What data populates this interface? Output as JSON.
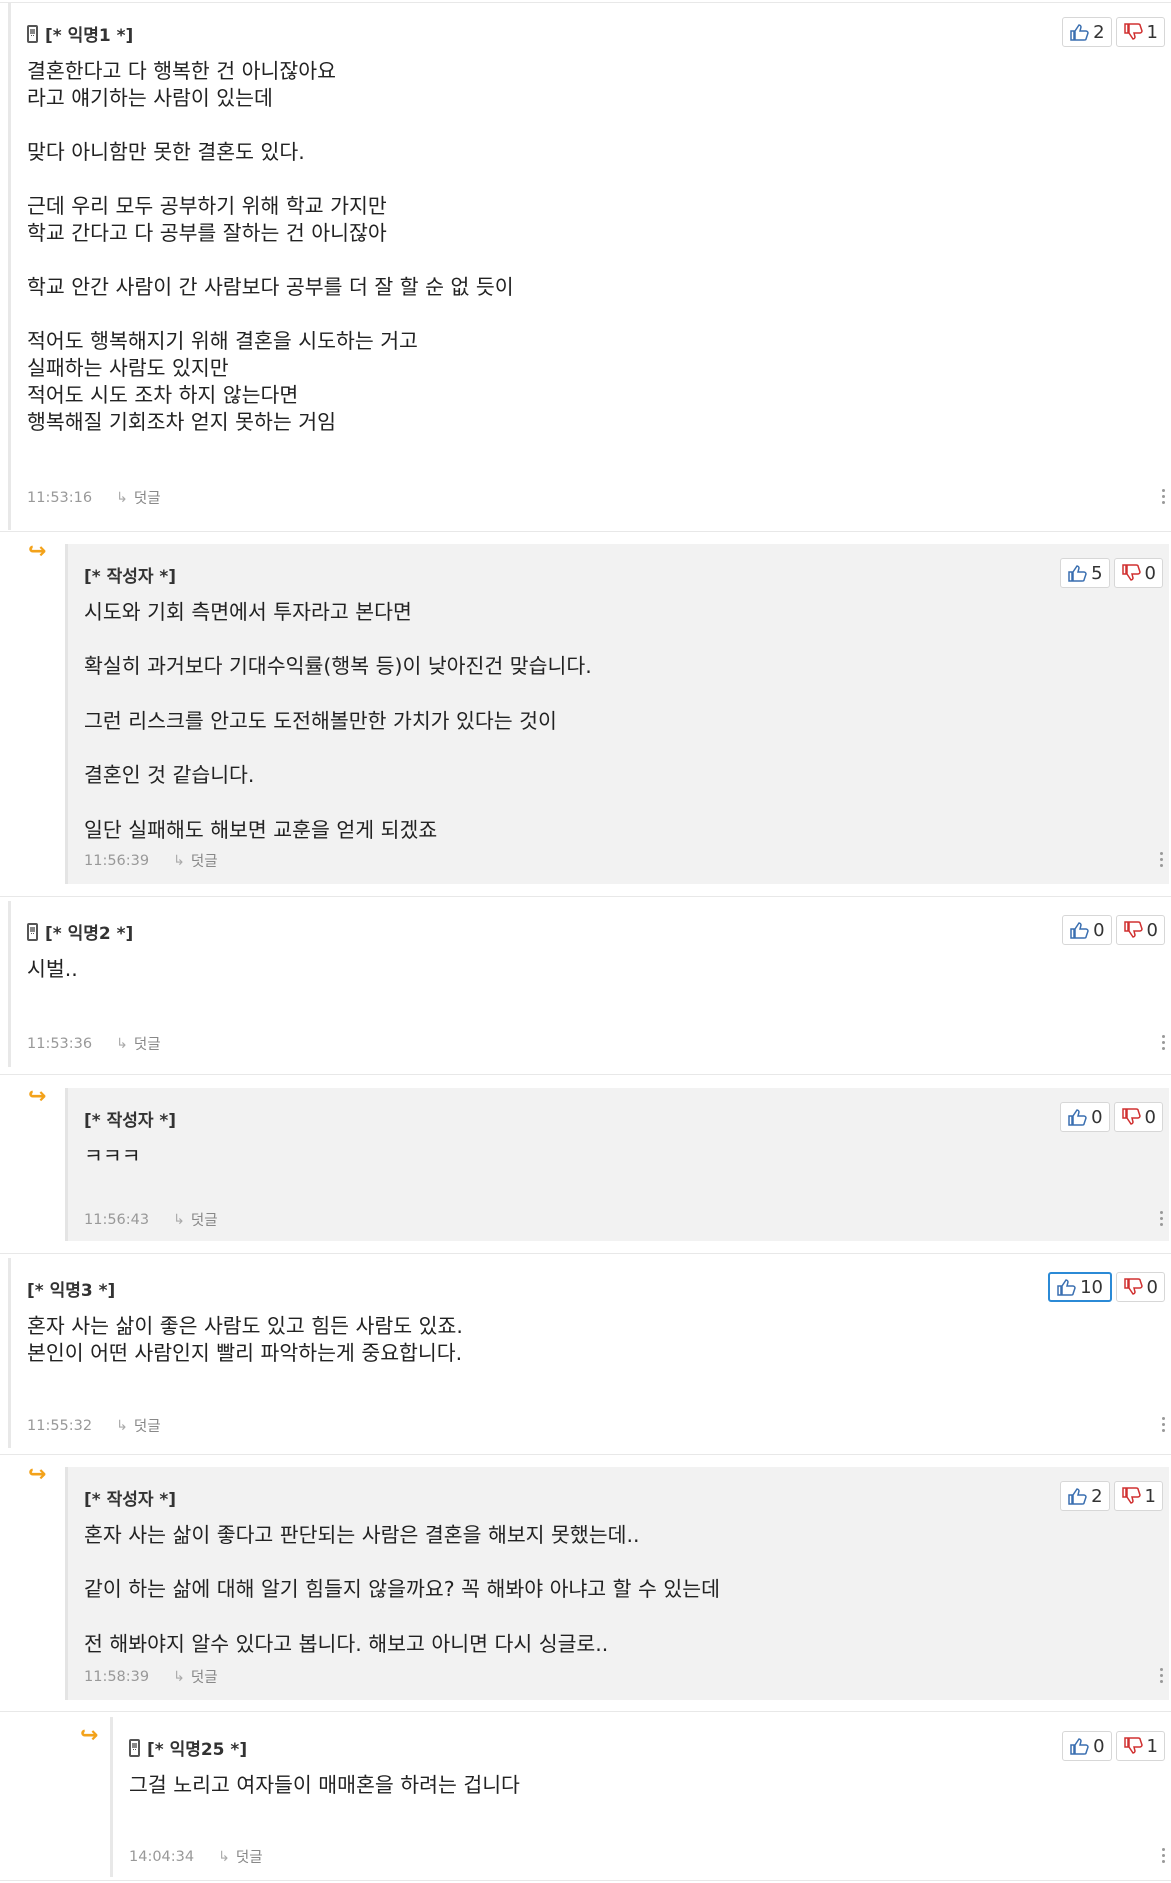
{
  "comments": [
    {
      "author": "[* 익명1 *]",
      "lines": [
        "결혼한다고 다 행복한 건 아니잖아요",
        "라고 얘기하는 사람이 있는데",
        "",
        "맞다 아니함만 못한 결혼도 있다.",
        "",
        "근데 우리 모두 공부하기 위해 학교 가지만",
        "학교 간다고 다 공부를 잘하는 건 아니잖아",
        "",
        "학교 안간 사람이 간 사람보다 공부를 더 잘 할 순 없 듯이",
        "",
        "적어도 행복해지기 위해 결혼을 시도하는 거고",
        "실패하는 사람도 있지만",
        "적어도 시도 조차 하지 않는다면",
        "행복해질 기회조차 얻지 못하는 거임"
      ],
      "time": "11:53:16",
      "reply_label": "덧글",
      "up": "2",
      "down": "1"
    },
    {
      "author": "[* 작성자 *]",
      "lines": [
        "시도와 기회 측면에서 투자라고 본다면",
        "",
        "확실히 과거보다 기대수익률(행복 등)이 낮아진건 맞습니다.",
        "",
        "그런 리스크를 안고도 도전해볼만한 가치가 있다는 것이",
        "",
        "결혼인 것 같습니다.",
        "",
        "일단 실패해도 해보면 교훈을 얻게 되겠죠"
      ],
      "time": "11:56:39",
      "reply_label": "덧글",
      "up": "5",
      "down": "0"
    },
    {
      "author": "[* 익명2 *]",
      "lines": [
        "시벌.."
      ],
      "time": "11:53:36",
      "reply_label": "덧글",
      "up": "0",
      "down": "0"
    },
    {
      "author": "[* 작성자 *]",
      "lines": [
        "ㅋㅋㅋ"
      ],
      "time": "11:56:43",
      "reply_label": "덧글",
      "up": "0",
      "down": "0"
    },
    {
      "author": "[* 익명3 *]",
      "lines": [
        "혼자 사는 삶이 좋은 사람도 있고 힘든 사람도 있죠.",
        "본인이 어떤 사람인지 빨리 파악하는게 중요합니다."
      ],
      "time": "11:55:32",
      "reply_label": "덧글",
      "up": "10",
      "down": "0"
    },
    {
      "author": "[* 작성자 *]",
      "lines": [
        "혼자 사는 삶이 좋다고 판단되는 사람은 결혼을 해보지 못했는데..",
        "",
        "같이 하는 삶에 대해 알기 힘들지 않을까요? 꼭 해봐야 아냐고 할 수 있는데",
        "",
        "전 해봐야지 알수 있다고 봅니다. 해보고 아니면 다시 싱글로.."
      ],
      "time": "11:58:39",
      "reply_label": "덧글",
      "up": "2",
      "down": "1"
    },
    {
      "author": "[* 익명25 *]",
      "lines": [
        "그걸 노리고 여자들이 매매혼을 하려는 겁니다"
      ],
      "time": "14:04:34",
      "reply_label": "덧글",
      "up": "0",
      "down": "1"
    }
  ]
}
